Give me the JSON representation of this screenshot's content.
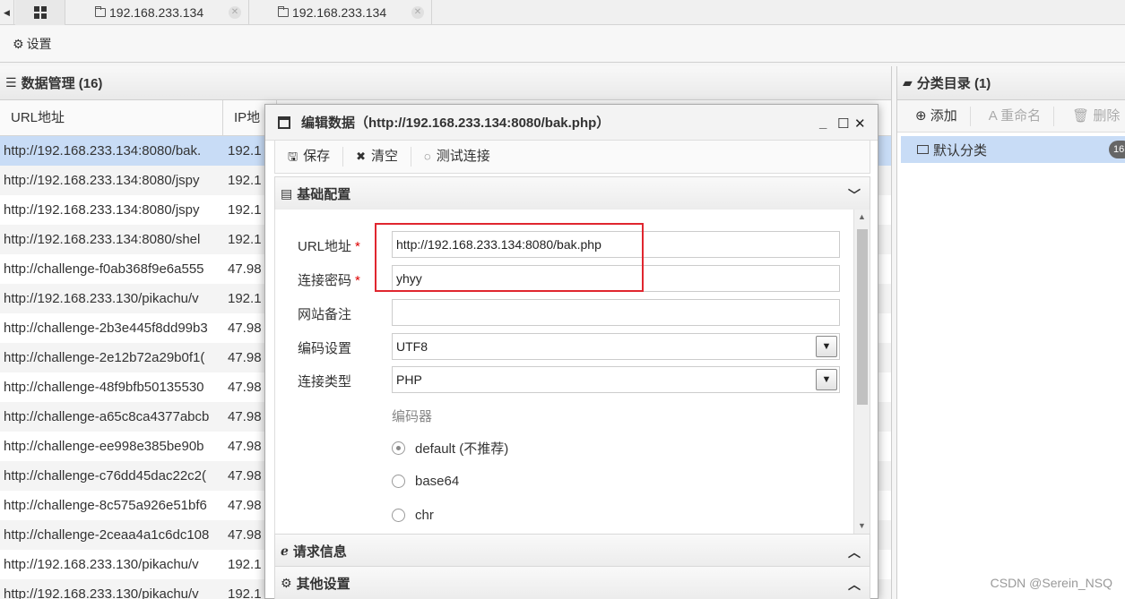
{
  "tabs": [
    {
      "label": "192.168.233.134"
    },
    {
      "label": "192.168.233.134"
    }
  ],
  "settings": {
    "label": "设置"
  },
  "data_panel": {
    "title": "数据管理 (16)",
    "columns": [
      "URL地址",
      "IP地"
    ],
    "rows": [
      {
        "url": "http://192.168.233.134:8080/bak.",
        "ip": "192.1"
      },
      {
        "url": "http://192.168.233.134:8080/jspy",
        "ip": "192.1"
      },
      {
        "url": "http://192.168.233.134:8080/jspy",
        "ip": "192.1"
      },
      {
        "url": "http://192.168.233.134:8080/shel",
        "ip": "192.1"
      },
      {
        "url": "http://challenge-f0ab368f9e6a555",
        "ip": "47.98"
      },
      {
        "url": "http://192.168.233.130/pikachu/v",
        "ip": "192.1"
      },
      {
        "url": "http://challenge-2b3e445f8dd99b3",
        "ip": "47.98"
      },
      {
        "url": "http://challenge-2e12b72a29b0f1(",
        "ip": "47.98"
      },
      {
        "url": "http://challenge-48f9bfb50135530",
        "ip": "47.98"
      },
      {
        "url": "http://challenge-a65c8ca4377abcb",
        "ip": "47.98"
      },
      {
        "url": "http://challenge-ee998e385be90b",
        "ip": "47.98"
      },
      {
        "url": "http://challenge-c76dd45dac22c2(",
        "ip": "47.98"
      },
      {
        "url": "http://challenge-8c575a926e51bf6",
        "ip": "47.98"
      },
      {
        "url": "http://challenge-2ceaa4a1c6dc108",
        "ip": "47.98"
      },
      {
        "url": "http://192.168.233.130/pikachu/v",
        "ip": "192.1"
      },
      {
        "url": "http://192.168.233.130/pikachu/v",
        "ip": "192.1"
      }
    ]
  },
  "category_panel": {
    "title": "分类目录 (1)",
    "add": "添加",
    "rename": "重命名",
    "delete": "删除",
    "item": "默认分类",
    "badge": "16"
  },
  "modal": {
    "title": "编辑数据（http://192.168.233.134:8080/bak.php）",
    "save": "保存",
    "clear": "清空",
    "test": "测试连接",
    "section_basic": "基础配置",
    "section_request": "请求信息",
    "section_other": "其他设置",
    "fields": {
      "url_label": "URL地址",
      "url_value": "http://192.168.233.134:8080/bak.php",
      "password_label": "连接密码",
      "password_value": "yhyy",
      "note_label": "网站备注",
      "note_value": "",
      "encoding_label": "编码设置",
      "encoding_value": "UTF8",
      "type_label": "连接类型",
      "type_value": "PHP",
      "required_mark": "*"
    },
    "encoder": {
      "title": "编码器",
      "options": [
        "default (不推荐)",
        "base64",
        "chr"
      ],
      "selected": "default (不推荐)"
    }
  },
  "watermark": "CSDN @Serein_NSQ",
  "colors": {
    "selected_row": "#c8dcf6",
    "highlight_box": "#e0262f",
    "required": "#dd0000"
  }
}
